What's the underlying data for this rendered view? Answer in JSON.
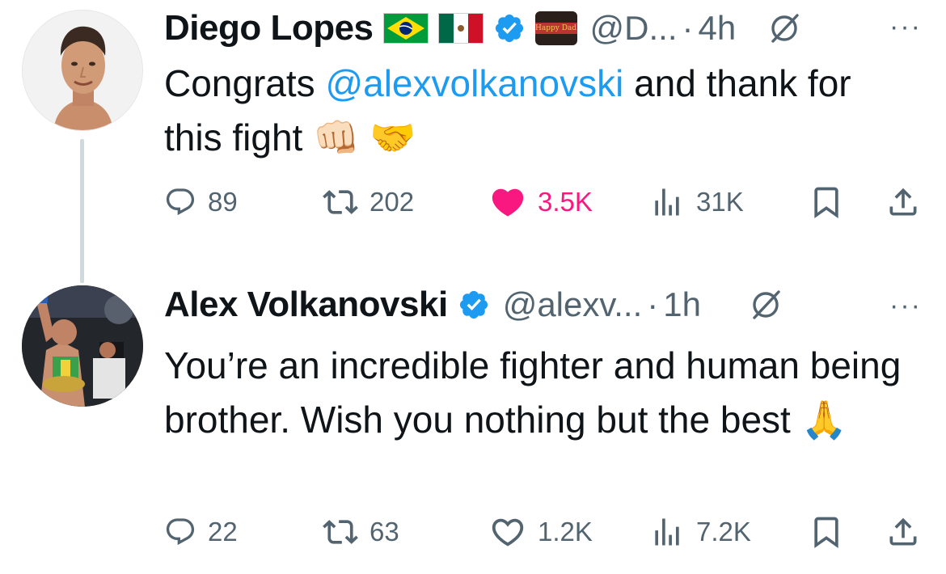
{
  "tweets": [
    {
      "name": "Diego Lopes",
      "badges": [
        "flag-brazil",
        "flag-mexico",
        "verified-badge",
        "affiliate-badge"
      ],
      "affiliate_badge_text": "Happy Dad",
      "handle": "@D...",
      "separator": "·",
      "time": "4h",
      "more": "···",
      "text_parts": {
        "before": "Congrats ",
        "mention": "@alexvolkanovski",
        "after": " and thank for this fight",
        "emoji": "👊🏻 🤝"
      },
      "actions": {
        "replies": "89",
        "reposts": "202",
        "likes": "3.5K",
        "views": "31K"
      },
      "liked": true
    },
    {
      "name": "Alex Volkanovski",
      "badges": [
        "verified-badge"
      ],
      "handle": "@alexv...",
      "separator": "·",
      "time": "1h",
      "more": "···",
      "text": "You’re an incredible fighter and human being brother. Wish you nothing but the best",
      "emoji": "🙏",
      "actions": {
        "replies": "22",
        "reposts": "63",
        "likes": "1.2K",
        "views": "7.2K"
      },
      "liked": false
    }
  ],
  "colors": {
    "accent": "#1d9bf0",
    "like_active": "#f91880",
    "secondary_text": "#536471",
    "primary_text": "#0f1419",
    "thread_line": "#cfd9de"
  }
}
